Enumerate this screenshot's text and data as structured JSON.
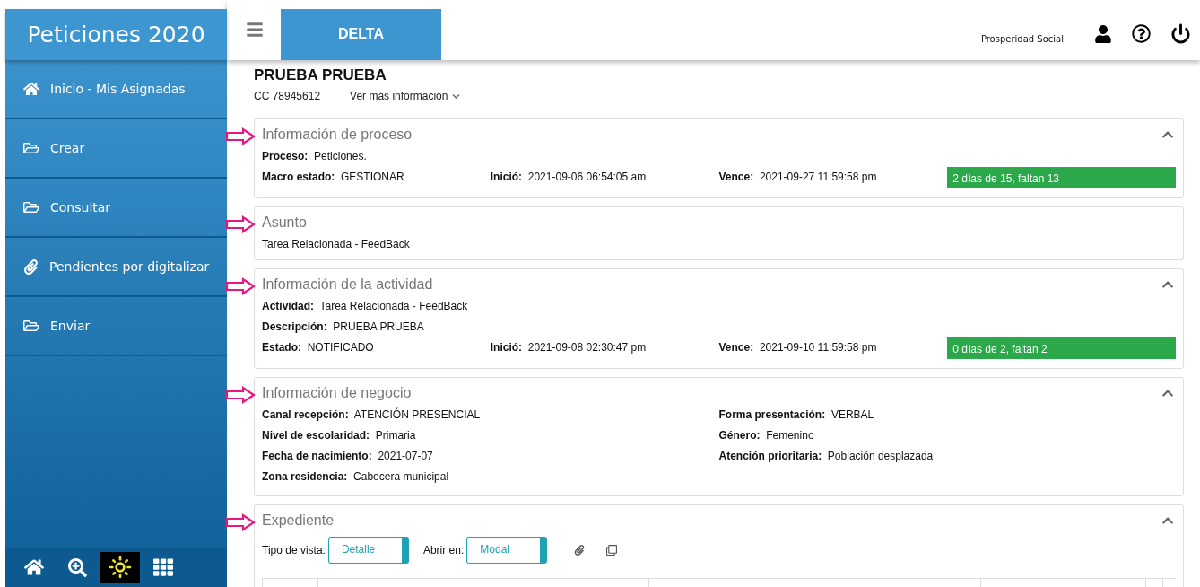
{
  "sidebar": {
    "title": "Peticiones 2020",
    "items": [
      {
        "kind": "home",
        "label": "Inicio - Mis Asignadas"
      },
      {
        "kind": "folder",
        "label": "Crear"
      },
      {
        "kind": "folder",
        "label": "Consultar"
      },
      {
        "kind": "clip",
        "label": "Pendientes por digitalizar"
      },
      {
        "kind": "folder",
        "label": "Enviar"
      }
    ],
    "toolbar": [
      {
        "kind": "home",
        "selected": false
      },
      {
        "kind": "zoom",
        "selected": false
      },
      {
        "kind": "sun",
        "selected": true
      },
      {
        "kind": "apps",
        "selected": false
      }
    ]
  },
  "topbar": {
    "tab": "DELTA",
    "org": "Prosperidad Social"
  },
  "person": {
    "name": "PRUEBA PRUEBA",
    "id": "CC 78945612",
    "more": "Ver más información"
  },
  "sections": [
    {
      "title": "Información de proceso",
      "kind": "grid4",
      "expanded": true,
      "rows": [
        [
          {
            "label": "Proceso:",
            "value": "Peticiones."
          }
        ],
        [
          {
            "label": "Macro estado:",
            "value": "GESTIONAR"
          },
          {
            "label": "Inició:",
            "value": "2021-09-06 06:54:05 am"
          },
          {
            "label": "Vence:",
            "value": "2021-09-27 11:59:58 pm"
          },
          {
            "kind": "badge",
            "value": "2 días de 15, faltan 13"
          }
        ]
      ]
    },
    {
      "title": "Asunto",
      "kind": "text",
      "text": "Tarea Relacionada - FeedBack"
    },
    {
      "title": "Información de la actividad",
      "kind": "grid4",
      "expanded": true,
      "rows": [
        [
          {
            "label": "Actividad:",
            "value": "Tarea Relacionada - FeedBack"
          }
        ],
        [
          {
            "label": "Descripción:",
            "value": "PRUEBA PRUEBA"
          }
        ],
        [
          {
            "label": "Estado:",
            "value": "NOTIFICADO"
          },
          {
            "label": "Inició:",
            "value": "2021-09-08 02:30:47 pm"
          },
          {
            "label": "Vence:",
            "value": "2021-09-10 11:59:58 pm"
          },
          {
            "kind": "badge",
            "value": "0 días de 2, faltan 2"
          }
        ]
      ]
    },
    {
      "title": "Información de negocio",
      "kind": "grid2",
      "expanded": true,
      "rows": [
        [
          {
            "label": "Canal recepción:",
            "value": "ATENCIÓN PRESENCIAL"
          },
          {
            "label": "Forma presentación:",
            "value": "VERBAL"
          }
        ],
        [
          {
            "label": "Nivel de escolaridad:",
            "value": "Primaria"
          },
          {
            "label": "Género:",
            "value": "Femenino"
          }
        ],
        [
          {
            "label": "Fecha de nacimiento:",
            "value": "2021-07-07"
          },
          {
            "label": "Atención prioritaria:",
            "value": "Población desplazada"
          }
        ],
        [
          {
            "label": "Zona residencia:",
            "value": "Cabecera municipal"
          }
        ]
      ]
    },
    {
      "title": "Expediente",
      "kind": "expediente",
      "expanded": true,
      "view_label": "Tipo de vista:",
      "view_value": "Detalle",
      "open_label": "Abrir en:",
      "open_value": "Modal"
    }
  ]
}
